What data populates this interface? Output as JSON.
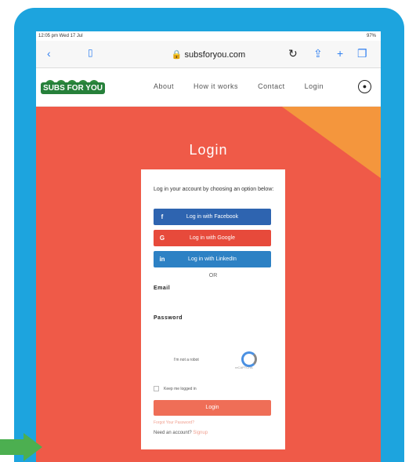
{
  "status_bar": {
    "time": "12:05 pm Wed 17 Jul",
    "battery": "97%"
  },
  "browser": {
    "url": "subsforyou.com"
  },
  "nav": {
    "logo_text": "SUBS FOR YOU",
    "links": [
      "About",
      "How it works",
      "Contact",
      "Login"
    ]
  },
  "login": {
    "title": "Login",
    "intro": "Log in your account by choosing an option below:",
    "facebook": "Log in with Facebook",
    "google": "Log in with Google",
    "linkedin": "Log in with LinkedIn",
    "or": "OR",
    "email_label": "Email",
    "password_label": "Password",
    "captcha_text": "I'm not a robot",
    "captcha_sub": "reCAPTCHA",
    "keep_logged": "Keep me logged in",
    "login_button": "Login",
    "forgot": "Forgot Your Password?",
    "need_account": "Need an account?",
    "signup": "Signup"
  },
  "colors": {
    "frame": "#1da4de",
    "hero": "#ef5a48",
    "accent": "#f4963d",
    "facebook": "#2e64b0",
    "google": "#e74a3b",
    "linkedin": "#2d81c4",
    "logo": "#26803a"
  }
}
